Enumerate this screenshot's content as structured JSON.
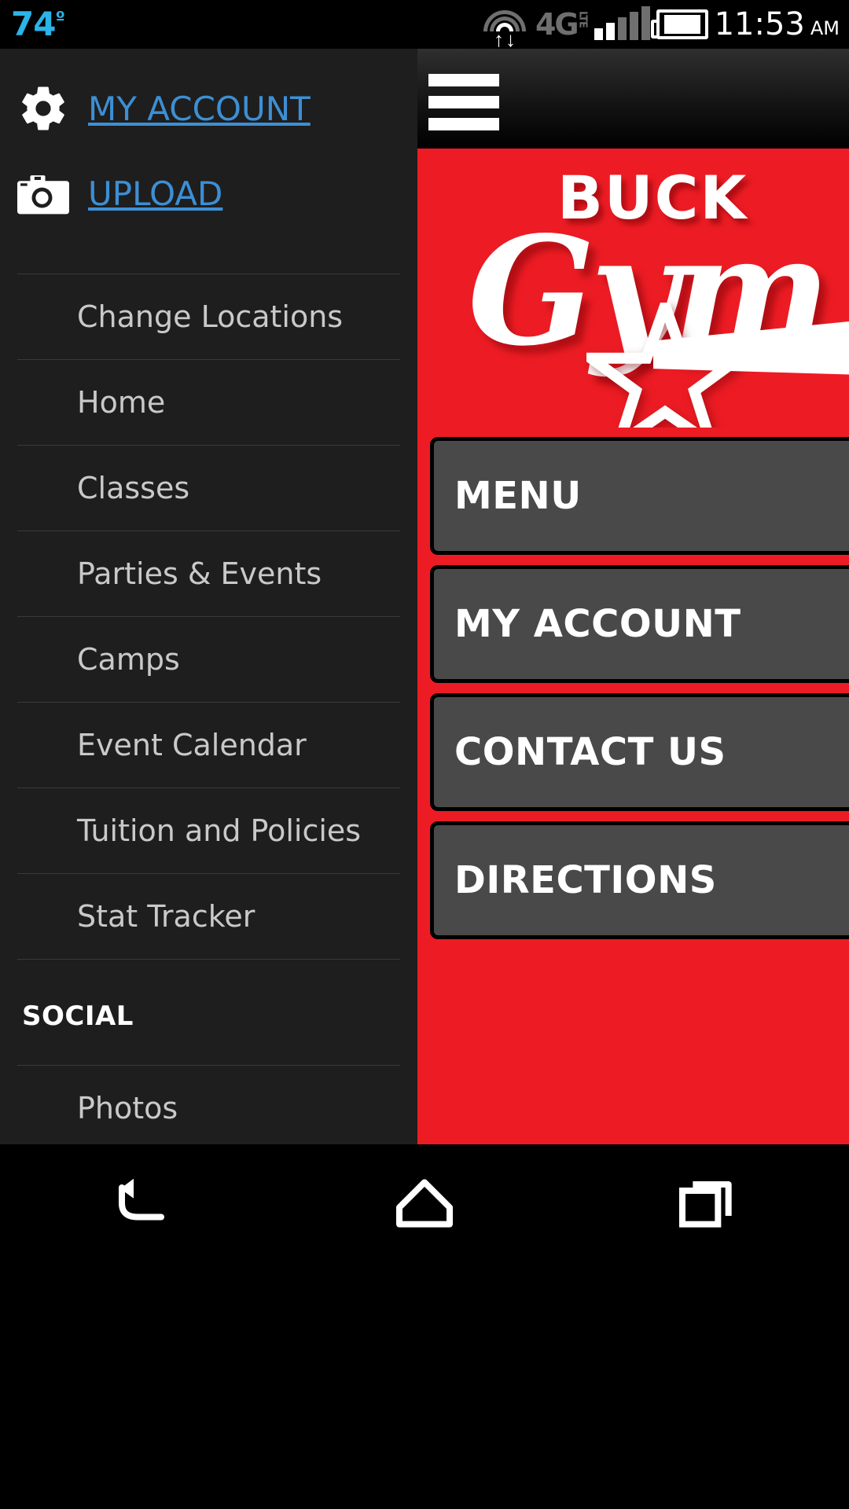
{
  "statusbar": {
    "temperature": "74",
    "degree": "º",
    "network": "4G",
    "network_sub": "LTE",
    "time": "11:53",
    "ampm": "AM",
    "icons": [
      "wifi-icon",
      "data-transfer-icon",
      "signal-bars-icon",
      "battery-icon"
    ],
    "signal_bars_filled": 2,
    "signal_bars_total": 5
  },
  "drawer": {
    "account": {
      "label": "MY ACCOUNT",
      "icon": "gear-icon"
    },
    "upload": {
      "label": "UPLOAD",
      "icon": "camera-icon"
    },
    "items": [
      {
        "label": "Change Locations"
      },
      {
        "label": "Home"
      },
      {
        "label": "Classes"
      },
      {
        "label": "Parties & Events"
      },
      {
        "label": "Camps"
      },
      {
        "label": "Event Calendar"
      },
      {
        "label": "Tuition and Policies"
      },
      {
        "label": "Stat Tracker"
      }
    ],
    "social_heading": "SOCIAL",
    "social_items": [
      {
        "label": "Photos"
      }
    ],
    "link_color": "#3d8fd4",
    "item_color": "#c9c9c9"
  },
  "content": {
    "appbar": {
      "menu_icon": "hamburger-menu-icon"
    },
    "logo": {
      "title_top": "BUCK",
      "title_script": "Gym",
      "star_icon": "star-icon"
    },
    "brand_red": "#ED1C24",
    "buttons": [
      {
        "label": "MENU"
      },
      {
        "label": "MY ACCOUNT"
      },
      {
        "label": "CONTACT US"
      },
      {
        "label": "DIRECTIONS"
      }
    ]
  },
  "navbar": {
    "back": "back-icon",
    "home": "home-icon",
    "recents": "recents-icon"
  }
}
